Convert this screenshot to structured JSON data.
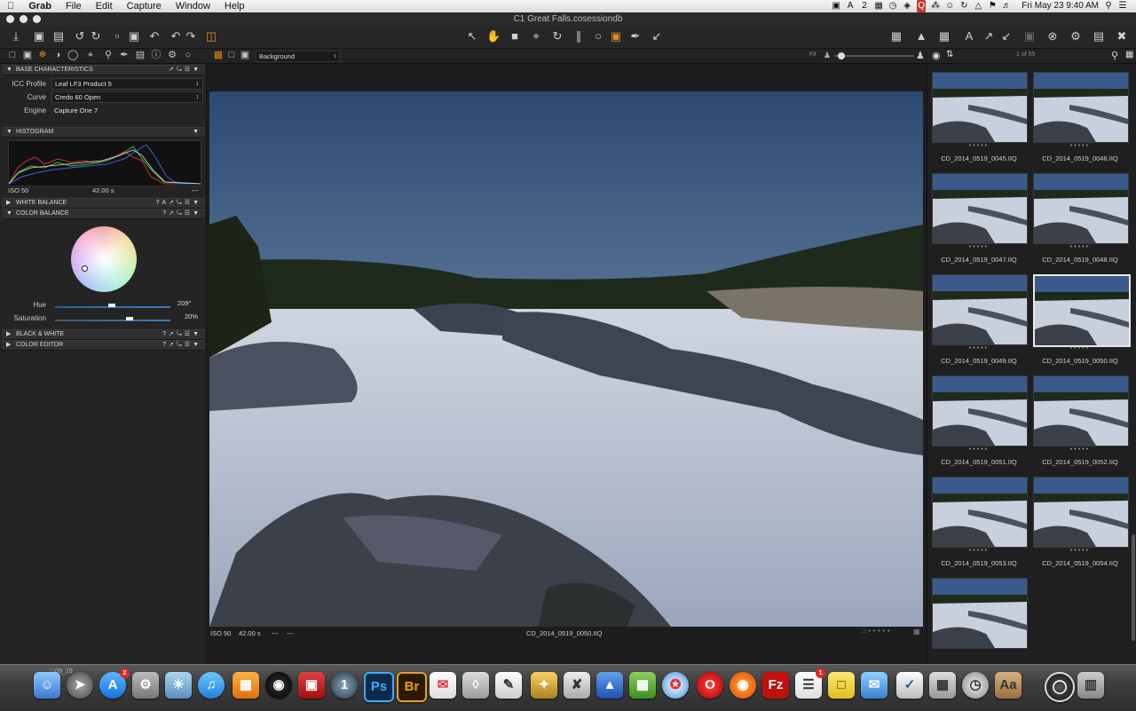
{
  "menubar": {
    "app_name": "Grab",
    "items": [
      "File",
      "Edit",
      "Capture",
      "Window",
      "Help"
    ],
    "status_number": "2",
    "clock": "Fri May 23  9:40 AM"
  },
  "window": {
    "title": "C1 Great Falls.cosessiondb"
  },
  "viewer_toolbar": {
    "variant_select": "Background",
    "fit_label": "Fit"
  },
  "browser_header": {
    "count": "1 of 55"
  },
  "left_panel": {
    "base_characteristics": {
      "header": "BASE CHARACTERISTICS",
      "icc_label": "ICC Profile",
      "icc_value": "Leaf LF3 Product 5",
      "curve_label": "Curve",
      "curve_value": "Credo 60 Open",
      "engine_label": "Engine",
      "engine_value": "Capture One 7"
    },
    "histogram": {
      "header": "HISTOGRAM",
      "iso": "ISO 50",
      "shutter": "42.00 s",
      "aperture": "---"
    },
    "white_balance": {
      "header": "WHITE BALANCE"
    },
    "color_balance": {
      "header": "COLOR BALANCE",
      "hue_label": "Hue",
      "hue_value": "209°",
      "hue_level": 0.58,
      "saturation_label": "Saturation",
      "saturation_value": "20%",
      "saturation_level": 0.6
    },
    "black_white": {
      "header": "BLACK & WHITE"
    },
    "color_editor": {
      "header": "COLOR EDITOR"
    }
  },
  "viewer_footer": {
    "iso": "ISO 50",
    "shutter": "42.00 s",
    "aperture": "---",
    "focal": "---",
    "filename": "CD_2014_0519_0050.IIQ"
  },
  "browser": {
    "thumbnails": [
      {
        "name": "CD_2014_0519_0045.IIQ"
      },
      {
        "name": "CD_2014_0519_0046.IIQ"
      },
      {
        "name": "CD_2014_0519_0047.IIQ"
      },
      {
        "name": "CD_2014_0519_0048.IIQ"
      },
      {
        "name": "CD_2014_0519_0049.IIQ"
      },
      {
        "name": "CD_2014_0519_0050.IIQ"
      },
      {
        "name": "CD_2014_0519_0051.IIQ"
      },
      {
        "name": "CD_2014_0519_0052.IIQ"
      },
      {
        "name": "CD_2014_0519_0053.IIQ"
      },
      {
        "name": "CD_2014_0519_0054.IIQ"
      },
      {
        "name": ""
      }
    ],
    "selected_index": 5
  },
  "dock": {
    "apps": [
      "Finder",
      "Launchpad",
      "App Store",
      "System Preferences",
      "iPhoto",
      "iTunes",
      "iBooks",
      "Aperture",
      "Photo Booth",
      "1Password",
      "Photoshop",
      "Bridge",
      "Airmail",
      "Preview",
      "TextEdit",
      "Script Editor",
      "Photo",
      "Keynote",
      "Numbers",
      "Safari",
      "Opera",
      "Firefox",
      "FileZilla",
      "Reminders",
      "Stickies",
      "Mail",
      "OmniFocus",
      "Calculator",
      "Time Machine",
      "Dictionary",
      "Capture One",
      "Trash"
    ],
    "badges": {
      "appstore": "2",
      "reminders": "1"
    }
  }
}
